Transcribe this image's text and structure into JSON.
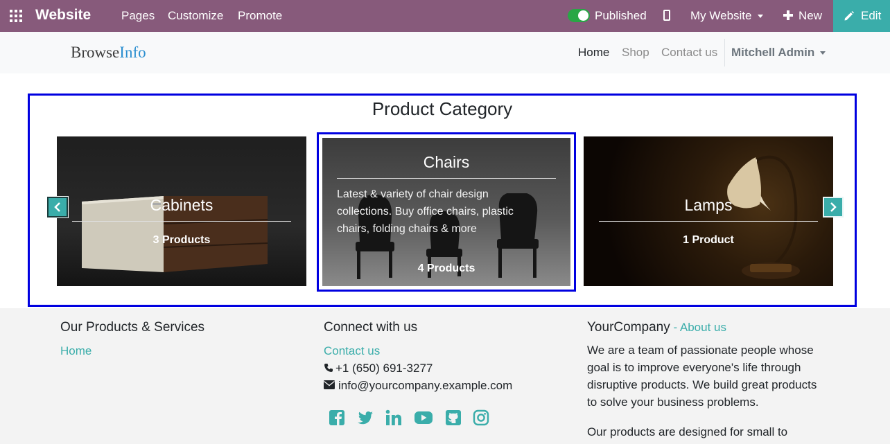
{
  "topbar": {
    "brand": "Website",
    "menu": [
      "Pages",
      "Customize",
      "Promote"
    ],
    "published_label": "Published",
    "website_selector": "My Website",
    "new_label": "New",
    "edit_label": "Edit",
    "published": true
  },
  "header": {
    "logo_part1": "Browse",
    "logo_part2": "Info",
    "nav": [
      "Home",
      "Shop",
      "Contact us"
    ],
    "active_nav": "Home",
    "user": "Mitchell Admin"
  },
  "section": {
    "title": "Product Category",
    "categories": [
      {
        "name": "Cabinets",
        "count": "3 Products"
      },
      {
        "name": "Chairs",
        "count": "4 Products",
        "description": "Latest & variety of chair design collections. Buy office chairs, plastic chairs, folding chairs & more"
      },
      {
        "name": "Lamps",
        "count": "1 Product"
      }
    ]
  },
  "footer": {
    "col1": {
      "heading": "Our Products & Services",
      "links": [
        "Home"
      ]
    },
    "col2": {
      "heading": "Connect with us",
      "contact_link": "Contact us",
      "phone": "+1 (650) 691-3277",
      "email": "info@yourcompany.example.com",
      "social_icons": [
        "facebook-icon",
        "twitter-icon",
        "linkedin-icon",
        "youtube-icon",
        "github-icon",
        "instagram-icon"
      ]
    },
    "col3": {
      "company": "YourCompany",
      "separator": " - ",
      "about_link": "About us",
      "para1": "We are a team of passionate people whose goal is to improve everyone's life through disruptive products. We build great products to solve your business problems.",
      "para2": "Our products are designed for small to"
    }
  },
  "colors": {
    "admin_bar": "#875a7b",
    "accent": "#3aadaa",
    "highlight_border": "#0000e0"
  }
}
